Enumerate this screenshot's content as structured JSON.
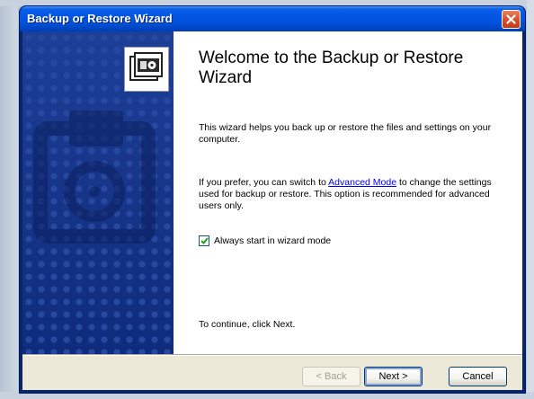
{
  "window": {
    "title": "Backup or Restore Wizard"
  },
  "content": {
    "heading": "Welcome to the Backup or Restore Wizard",
    "intro": "This wizard helps you back up or restore the files and settings on your computer.",
    "advanced_prefix": "If you prefer, you can switch to ",
    "advanced_link": "Advanced Mode",
    "advanced_suffix": " to change the settings used for backup or restore. This option is recommended for advanced users only.",
    "checkbox_label": "Always start in wizard mode",
    "checkbox_checked": true,
    "continue_text": "To continue, click Next."
  },
  "buttons": {
    "back": "< Back",
    "next": "Next >",
    "cancel": "Cancel"
  },
  "icons": {
    "close": "close-icon",
    "wizard": "backup-icon",
    "checkbox": "checkmark-icon"
  },
  "colors": {
    "titlebar": "#0054e3",
    "side_panel": "#1a3d96",
    "close_button": "#d8512e"
  }
}
